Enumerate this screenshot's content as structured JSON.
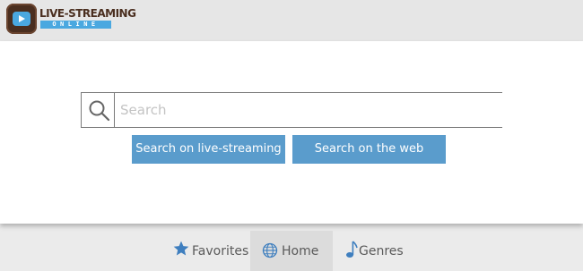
{
  "header": {
    "logo_title": "LIVE-STREAMING",
    "logo_subtitle": "ONLINE"
  },
  "search": {
    "placeholder": "Search",
    "value": "",
    "button_site_label": "Search on live-streaming",
    "button_web_label": "Search on the web"
  },
  "nav": {
    "favorites_label": "Favorites",
    "home_label": "Home",
    "genres_label": "Genres",
    "active": "Home"
  },
  "colors": {
    "button": "#5a9ccc",
    "logo_brown": "#4a2e1f",
    "logo_blue": "#4aa8e0",
    "icon_blue": "#3f7fbf"
  }
}
